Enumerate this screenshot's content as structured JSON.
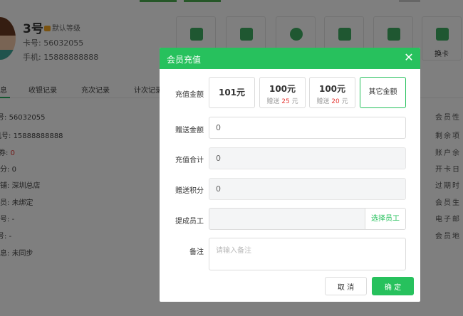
{
  "member": {
    "name": "3号",
    "level": "默认等级",
    "card_no": "卡号: 56032055",
    "phone": "手机: 15888888888"
  },
  "toolbar": [
    {
      "label": ""
    },
    {
      "label": ""
    },
    {
      "label": ""
    },
    {
      "label": ""
    },
    {
      "label": ""
    },
    {
      "label": "换卡"
    }
  ],
  "tabs": [
    {
      "label": "息"
    },
    {
      "label": "收银记录"
    },
    {
      "label": "充次记录"
    },
    {
      "label": "计次记录"
    }
  ],
  "info_left": [
    {
      "label": "卡号:",
      "value": "56032055"
    },
    {
      "label": "手机号:",
      "value": "15888888888"
    },
    {
      "label": "券:",
      "value": "0"
    },
    {
      "label": "积分:",
      "value": "0"
    },
    {
      "label": "店铺:",
      "value": "深圳总店"
    },
    {
      "label": "会员:",
      "value": "未绑定"
    },
    {
      "label": "卡号:",
      "value": "-"
    },
    {
      "label": "号:",
      "value": "-"
    },
    {
      "label": "信息:",
      "value": "未同步"
    }
  ],
  "info_right": [
    {
      "label": "会员性"
    },
    {
      "label": "剩余项"
    },
    {
      "label": "账户余"
    },
    {
      "label": "开卡日"
    },
    {
      "label": "过期时"
    },
    {
      "label": "会员生"
    },
    {
      "label": "电子邮"
    },
    {
      "label": "会员地"
    }
  ],
  "modal": {
    "title": "会员充值",
    "close_label": "✕",
    "amount_label": "充值金额",
    "options": [
      {
        "amount": "101元"
      },
      {
        "amount": "100元",
        "gift_prefix": "赠送",
        "gift_value": "25",
        "gift_unit": "元"
      },
      {
        "amount": "100元",
        "gift_prefix": "赠送",
        "gift_value": "20",
        "gift_unit": "元"
      },
      {
        "amount": "其它金额"
      }
    ],
    "gift_amount_label": "赠送金额",
    "gift_amount_value": "0",
    "total_label": "充值合计",
    "total_value": "0",
    "gift_points_label": "赠送积分",
    "gift_points_value": "0",
    "staff_label": "提成员工",
    "staff_value": "",
    "staff_button": "选择员工",
    "remark_label": "备注",
    "remark_placeholder": "请输入备注",
    "cancel_label": "取 消",
    "ok_label": "确 定"
  },
  "colors": {
    "accent": "#27c15d",
    "gift_red": "#e53935"
  }
}
